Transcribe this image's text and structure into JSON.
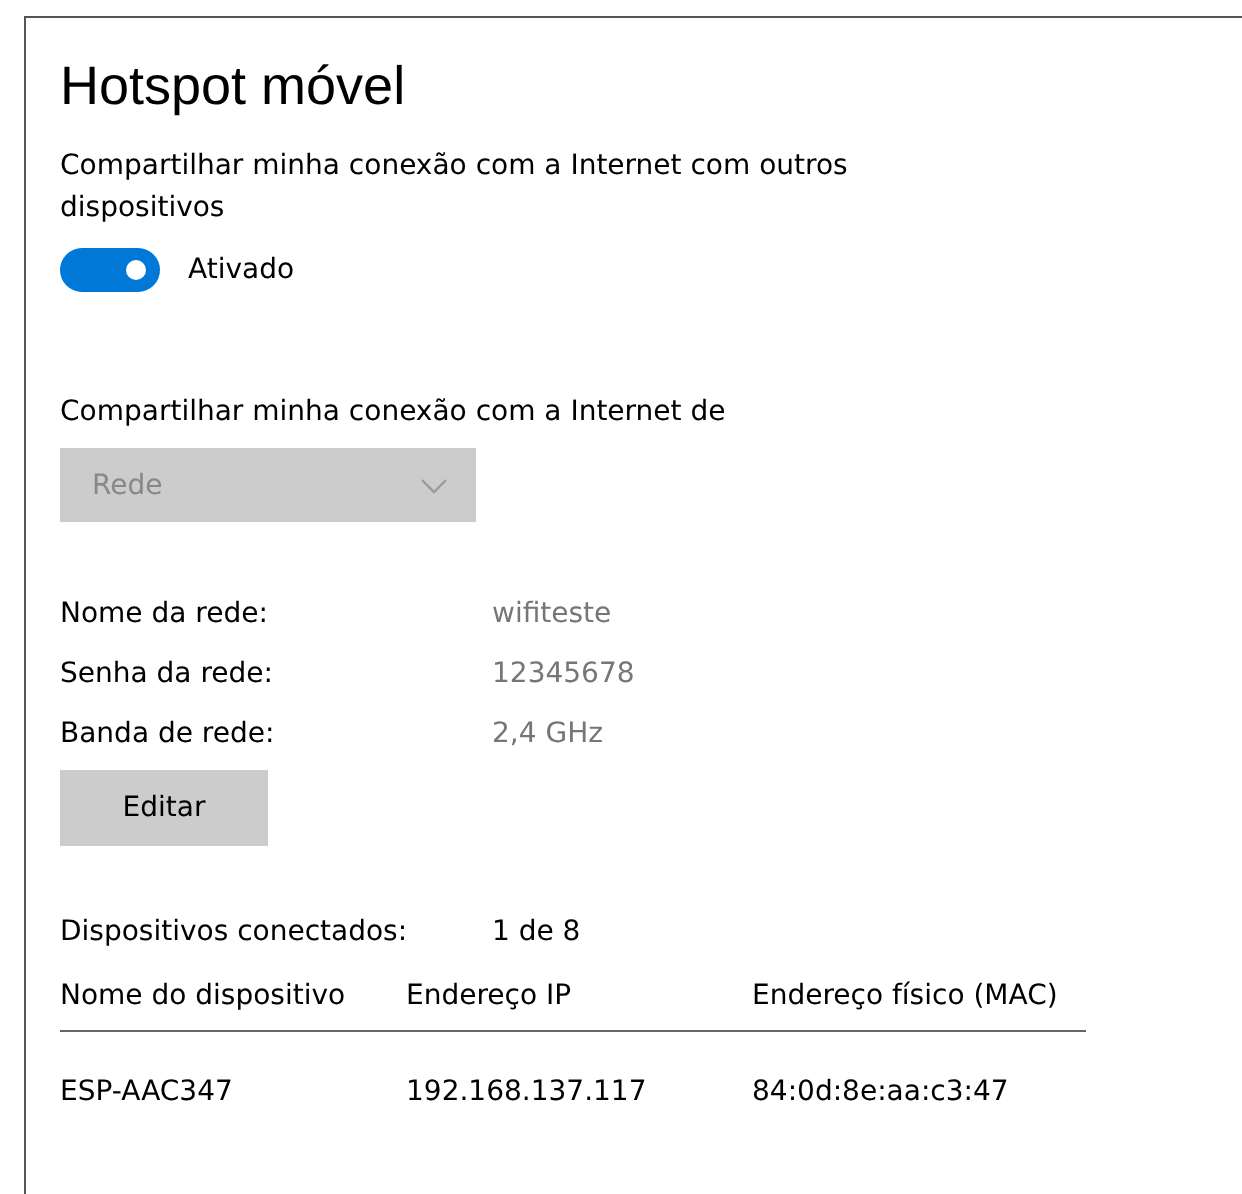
{
  "title": "Hotspot móvel",
  "share": {
    "label": "Compartilhar minha conexão com a Internet com outros dispositivos",
    "on": true,
    "state_label": "Ativado"
  },
  "share_from": {
    "label": "Compartilhar minha conexão com a Internet de",
    "value": "Rede",
    "disabled": true
  },
  "properties": [
    {
      "label": "Nome da rede:",
      "value": "wifiteste"
    },
    {
      "label": "Senha da rede:",
      "value": "12345678"
    },
    {
      "label": "Banda de rede:",
      "value": "2,4 GHz"
    }
  ],
  "edit_button": "Editar",
  "connected": {
    "label": "Dispositivos conectados:",
    "value": "1 de 8"
  },
  "table": {
    "columns": [
      "Nome do dispositivo",
      "Endereço IP",
      "Endereço físico (MAC)"
    ],
    "rows": [
      [
        "ESP-AAC347",
        "192.168.137.117",
        "84:0d:8e:aa:c3:47"
      ]
    ]
  }
}
